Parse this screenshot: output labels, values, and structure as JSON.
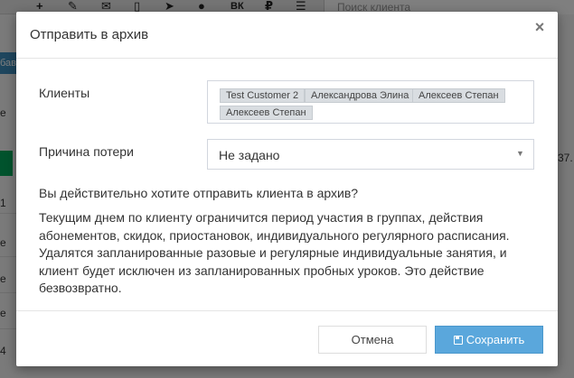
{
  "background": {
    "toolbar_icons": [
      "+",
      "✎",
      "✉",
      "▯",
      "➤",
      "●",
      "ВК",
      "₽",
      "☰"
    ],
    "search_placeholder": "Поиск клиента",
    "left_button_label": "бав",
    "left_letters": [
      "е",
      "1",
      "е",
      "е",
      "е",
      "4"
    ],
    "right_fragment": "37."
  },
  "modal": {
    "title": "Отправить в архив",
    "clients_label": "Клиенты",
    "clients": [
      "Test Customer 2",
      "Александрова Элина",
      "Алексеев Степан",
      "Алексеев Степан"
    ],
    "reason_label": "Причина потери",
    "reason_value": "Не задано",
    "question": "Вы действительно хотите отправить клиента в архив?",
    "warning": "Текущим днем по клиенту ограничится период участия в группах, действия абонементов, скидок, приостановок, индивидуального регулярного расписания. Удалятся запланированные разовые и регулярные индивидуальные занятия, и клиент будет исключен из запланированных пробных уроков. Это действие безвозвратно.",
    "cancel_label": "Отмена",
    "save_label": "Сохранить"
  }
}
